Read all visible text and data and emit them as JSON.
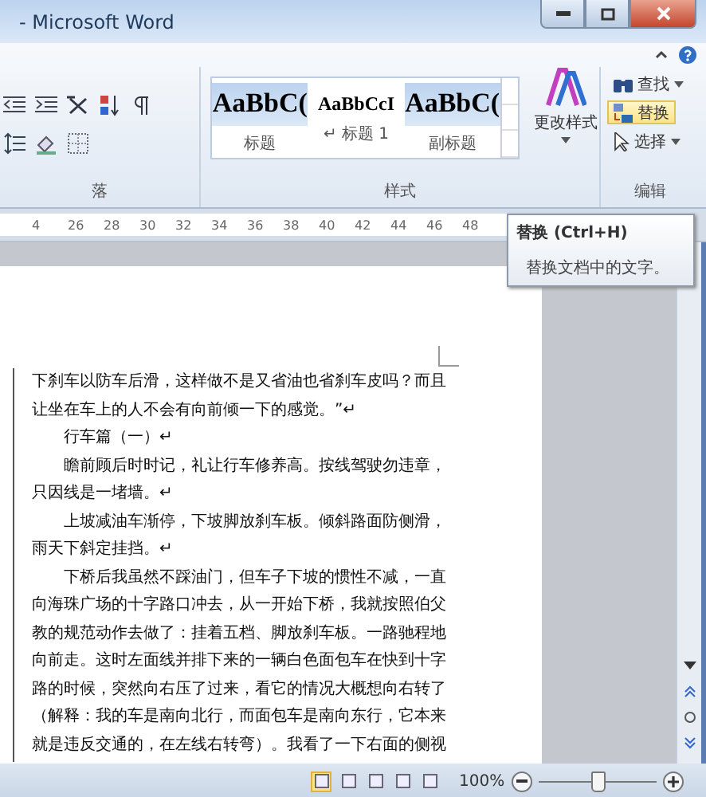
{
  "window": {
    "title": "- Microsoft Word"
  },
  "paragraph_group": {
    "label": "落"
  },
  "styles_group": {
    "label": "样式",
    "styles": [
      {
        "preview": "AaBbC(",
        "name": "标题",
        "kind": "title"
      },
      {
        "preview": "AaBbCcI",
        "name": "↵ 标题 1",
        "kind": "heading"
      },
      {
        "preview": "AaBbC(",
        "name": "副标题",
        "kind": "title"
      }
    ]
  },
  "change_styles_button": {
    "label": "更改样式"
  },
  "editing_group": {
    "label": "编辑",
    "items": [
      {
        "label": "查找",
        "kind": "find",
        "dropdown": true,
        "highlighted": false
      },
      {
        "label": "替换",
        "kind": "replace",
        "dropdown": false,
        "highlighted": true
      },
      {
        "label": "选择",
        "kind": "select",
        "dropdown": true,
        "highlighted": false
      }
    ]
  },
  "ruler": {
    "ticks": [
      "4",
      "26",
      "28",
      "30",
      "32",
      "34",
      "36",
      "38",
      "40",
      "42",
      "44",
      "46",
      "48"
    ]
  },
  "tooltip": {
    "title": "替换 (Ctrl+H)",
    "description": "替换文档中的文字。"
  },
  "document": {
    "paragraphs": [
      {
        "text": "下刹车以防车后滑，这样做不是又省油也省刹车皮吗？而且让坐在车上的人不会有向前倾一下的感觉。”↵",
        "indent": false
      },
      {
        "text": "行车篇（一）↵",
        "indent": true
      },
      {
        "text": "瞻前顾后时时记，礼让行车修养高。按线驾驶勿违章，只因线是一堵墙。↵",
        "indent": true
      },
      {
        "text": "上坡减油车渐停，下坡脚放刹车板。倾斜路面防侧滑，雨天下斜定挂挡。↵",
        "indent": true
      },
      {
        "text": "下桥后我虽然不踩油门，但车子下坡的惯性不减，一直向海珠广场的十字路口冲去，从一开始下桥，我就按照伯父教的规范动作去做了：挂着五档、脚放刹车板。一路驰程地向前走。这时左面线并排下来的一辆白色面包车在快到十字路的时候，突然向右压了过来，看它的情况大概想向右转了（解释：我的车是南向北行，而面包车是南向东行，它本来就是违反交通的，在左线右转弯）。我看了一下右面的侧视",
        "indent": true
      }
    ]
  },
  "status_bar": {
    "views": [
      {
        "selected": true
      },
      {
        "selected": false
      },
      {
        "selected": false
      },
      {
        "selected": false
      },
      {
        "selected": false
      }
    ],
    "zoom": "100%",
    "zoom_slider": {
      "level": 0.5
    }
  }
}
